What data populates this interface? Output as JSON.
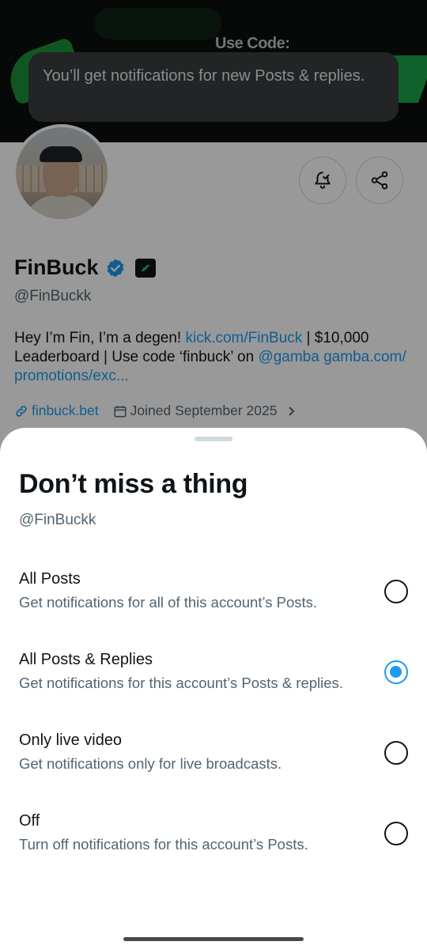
{
  "banner": {
    "code_text": "Use Code:"
  },
  "toast": {
    "text": "You’ll get notifications for new Posts & replies."
  },
  "profile": {
    "display_name": "FinBuck",
    "handle": "@FinBuckk",
    "bio": {
      "part1": "Hey I’m Fin, I’m a degen! ",
      "link1": "kick.com/FinBuck",
      "part2": " | $10,000 Leaderboard | Use code ‘finbuck’ on ",
      "mention": "@gamba",
      "part3": " ",
      "link2": "gamba.com/ promotions/exc..."
    },
    "website": "finbuck.bet",
    "joined": "Joined September 2025"
  },
  "sheet": {
    "title": "Don’t miss a thing",
    "handle": "@FinBuckk",
    "selected_option": "All Posts & Replies",
    "options": [
      {
        "title": "All Posts",
        "description": "Get notifications for all of this account’s Posts."
      },
      {
        "title": "All Posts & Replies",
        "description": "Get notifications for this account’s Posts & replies."
      },
      {
        "title": "Only live video",
        "description": "Get notifications only for live broadcasts."
      },
      {
        "title": "Off",
        "description": "Turn off notifications for this account’s Posts."
      }
    ]
  },
  "icons": {
    "bell": "bell-check-icon",
    "share": "share-icon",
    "verified": "verified-badge-icon",
    "affiliate": "affiliate-logo-icon",
    "link": "link-icon",
    "calendar": "calendar-icon",
    "chevron": "chevron-right-icon"
  },
  "colors": {
    "accent": "#1d9bf0",
    "text": "#0f1419",
    "secondary": "#536471",
    "toast_bg": "#3a3d40"
  }
}
